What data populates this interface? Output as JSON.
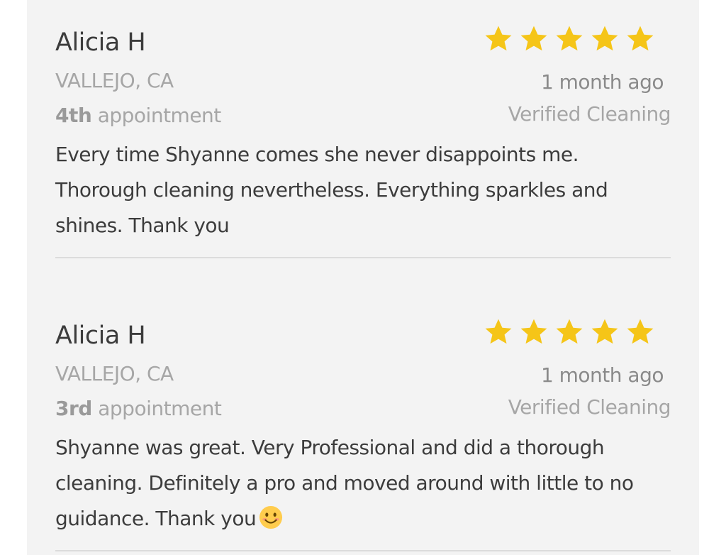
{
  "reviews": [
    {
      "name": "Alicia H",
      "location": "VALLEJO, CA",
      "appointment_ordinal": "4th",
      "appointment_label": " appointment",
      "time_ago": "1 month ago",
      "verified": "Verified Cleaning",
      "rating": 5,
      "text": "Every time Shyanne comes she never disappoints me. Thorough cleaning nevertheless. Everything sparkles and shines. Thank you"
    },
    {
      "name": "Alicia H",
      "location": "VALLEJO, CA",
      "appointment_ordinal": "3rd",
      "appointment_label": " appointment",
      "time_ago": "1 month ago",
      "verified": "Verified Cleaning",
      "rating": 5,
      "text": "Shyanne was great. Very Professional and did a thorough cleaning. Definitely a pro and moved around with little to no guidance. Thank you",
      "emoji": "smiling-face-icon"
    }
  ],
  "colors": {
    "star": "#f5c518",
    "panel_bg": "#f3f3f3",
    "text_dark": "#3c3c3c",
    "text_muted": "#a6a6a6"
  }
}
